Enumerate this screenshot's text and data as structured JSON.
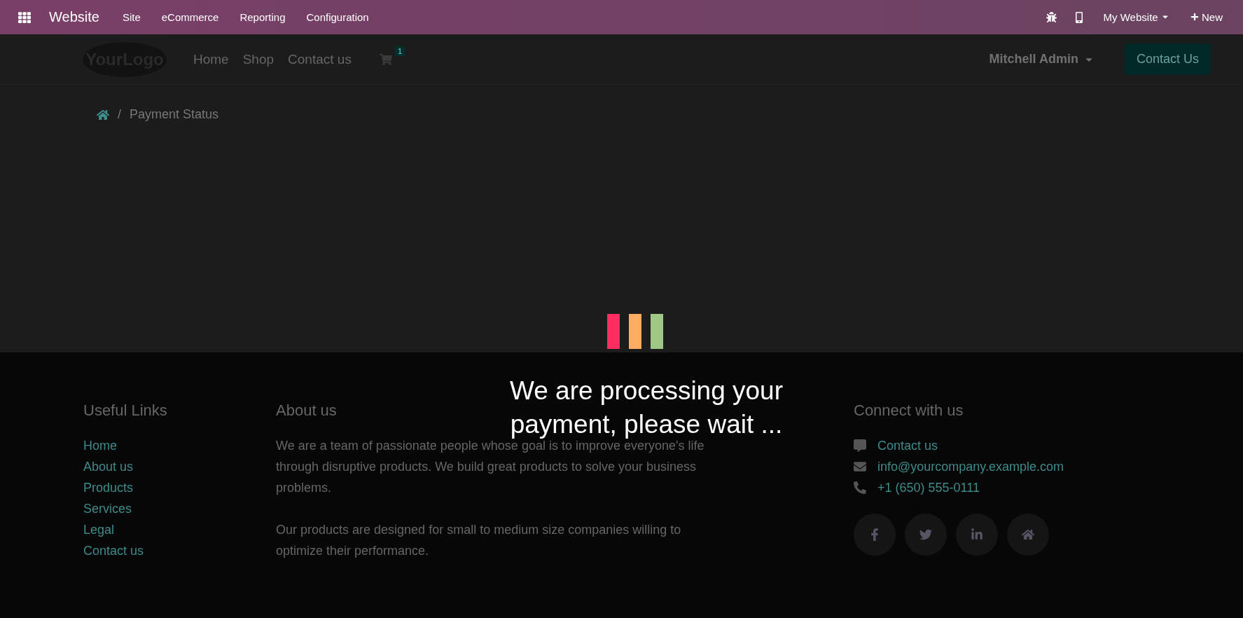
{
  "topbar": {
    "app": "Website",
    "menus": [
      "Site",
      "eCommerce",
      "Reporting",
      "Configuration"
    ],
    "website": "My Website",
    "new": "New"
  },
  "header": {
    "logo": {
      "first": "Your",
      "second": "Logo"
    },
    "nav": [
      "Home",
      "Shop",
      "Contact us"
    ],
    "cart_count": "1",
    "user": "Mitchell Admin",
    "cta": "Contact Us"
  },
  "breadcrumb": {
    "separator": "/",
    "current": "Payment Status"
  },
  "loader": {
    "bars": [
      {
        "color": "#ff2c62"
      },
      {
        "color": "#ffad62"
      },
      {
        "color": "#a0c785"
      }
    ],
    "message": "We are processing your payment, please wait ..."
  },
  "footer": {
    "useful_links": {
      "title": "Useful Links",
      "links": [
        "Home",
        "About us",
        "Products",
        "Services",
        "Legal",
        "Contact us"
      ]
    },
    "about": {
      "title": "About us",
      "paragraphs": [
        "We are a team of passionate people whose goal is to improve everyone's life through disruptive products. We build great products to solve your business problems.",
        "Our products are designed for small to medium size companies willing to optimize their performance."
      ]
    },
    "connect": {
      "title": "Connect with us",
      "items": [
        {
          "kind": "chat",
          "text": "Contact us"
        },
        {
          "kind": "mail",
          "text": "info@yourcompany.example.com"
        },
        {
          "kind": "phone",
          "text": "+1 (650) 555-0111"
        }
      ],
      "socials": [
        {
          "kind": "facebook"
        },
        {
          "kind": "twitter"
        },
        {
          "kind": "linkedin"
        },
        {
          "kind": "home"
        }
      ]
    }
  }
}
